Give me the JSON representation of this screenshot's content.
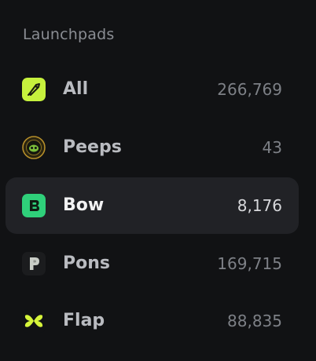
{
  "section": {
    "title": "Launchpads"
  },
  "items": [
    {
      "label": "All",
      "count": "266,769",
      "icon": "pad-all-icon",
      "active": false
    },
    {
      "label": "Peeps",
      "count": "43",
      "icon": "pad-peeps-icon",
      "active": false
    },
    {
      "label": "Bow",
      "count": "8,176",
      "icon": "pad-bow-icon",
      "active": true
    },
    {
      "label": "Pons",
      "count": "169,715",
      "icon": "pad-pons-icon",
      "active": false
    },
    {
      "label": "Flap",
      "count": "88,835",
      "icon": "pad-flap-icon",
      "active": false
    }
  ],
  "colors": {
    "background": "#111214",
    "active_row": "#212226",
    "all_icon": "#c6f13d",
    "bow_icon": "#2fd07a",
    "flap_icon": "#d6f53a"
  }
}
